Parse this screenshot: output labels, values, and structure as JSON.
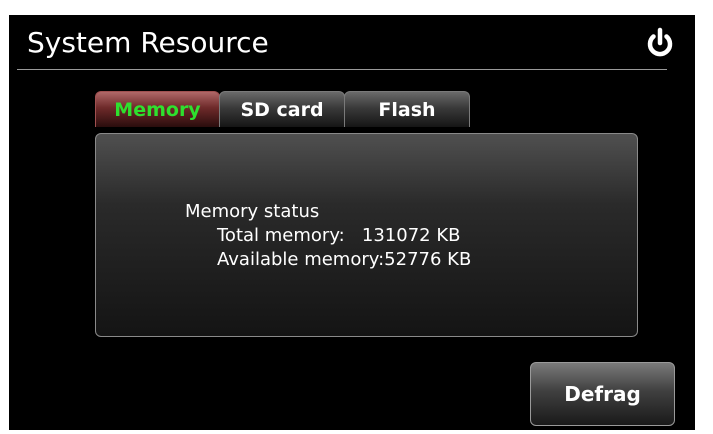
{
  "header": {
    "title": "System Resource",
    "power_icon": "power-icon"
  },
  "tabs": [
    {
      "label": "Memory",
      "active": true
    },
    {
      "label": "SD card",
      "active": false
    },
    {
      "label": "Flash",
      "active": false
    }
  ],
  "memory_panel": {
    "status_title": "Memory status",
    "total_line": "Total memory:   131072 KB",
    "available_line": "Available memory:52776 KB"
  },
  "actions": {
    "defrag_label": "Defrag"
  },
  "colors": {
    "background": "#000000",
    "active_tab_text": "#2ee02e",
    "active_tab": "#6e2a2a",
    "text": "#ffffff"
  }
}
